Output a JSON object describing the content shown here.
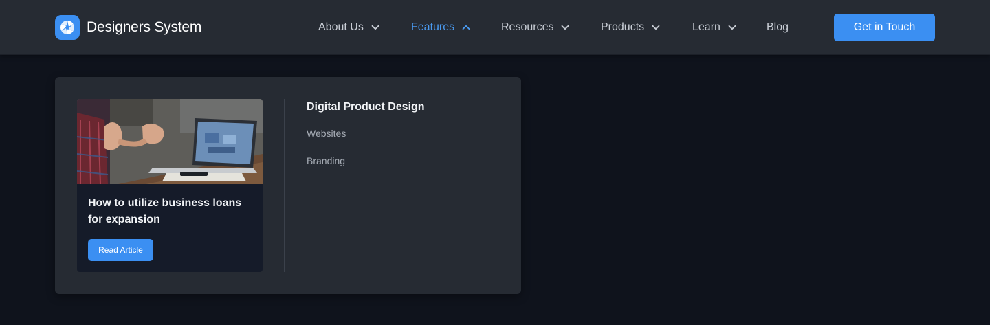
{
  "brand": {
    "name": "Designers System",
    "logo_icon": "aperture-icon",
    "logo_color": "#3b8ff2"
  },
  "nav": {
    "items": [
      {
        "label": "About Us",
        "has_dropdown": true,
        "open": false
      },
      {
        "label": "Features",
        "has_dropdown": true,
        "open": true
      },
      {
        "label": "Resources",
        "has_dropdown": true,
        "open": false
      },
      {
        "label": "Products",
        "has_dropdown": true,
        "open": false
      },
      {
        "label": "Learn",
        "has_dropdown": true,
        "open": false
      },
      {
        "label": "Blog",
        "has_dropdown": false,
        "open": false
      }
    ],
    "active_color": "#4a9bf2"
  },
  "cta": {
    "label": "Get in Touch",
    "color": "#3b8ff2"
  },
  "dropdown": {
    "featured": {
      "image_icon": "laptop-meeting-photo",
      "title": "How to utilize business loans for expansion",
      "button_label": "Read Article"
    },
    "column": {
      "heading": "Digital Product Design",
      "links": [
        "Websites",
        "Branding"
      ]
    }
  }
}
